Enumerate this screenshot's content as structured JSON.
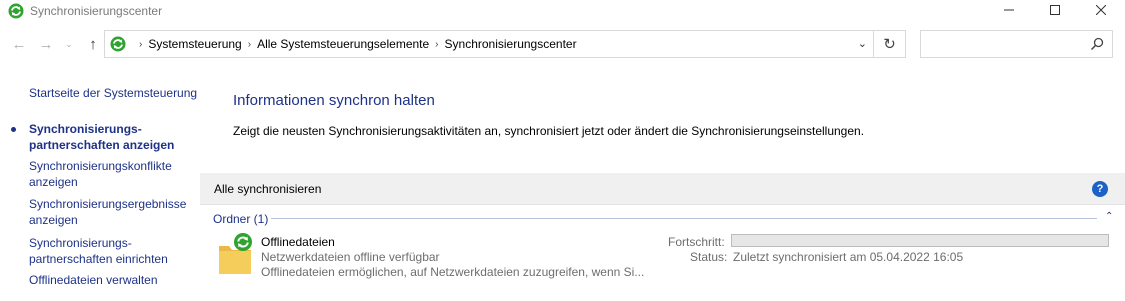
{
  "window": {
    "title": "Synchronisierungscenter",
    "controls": {
      "minimize": "—",
      "maximize": "☐",
      "close": "✕"
    }
  },
  "nav": {
    "back": "←",
    "forward": "→",
    "recent": "⌄",
    "up": "↑",
    "breadcrumbs": [
      "Systemsteuerung",
      "Alle Systemsteuerungselemente",
      "Synchronisierungscenter"
    ],
    "refresh": "↻",
    "search": {
      "value": "",
      "placeholder": ""
    }
  },
  "sidebar": {
    "items": [
      {
        "label": "Startseite der Systemsteuerung"
      },
      {
        "label_line1": "Synchronisierungs-",
        "label_line2": "partnerschaften anzeigen",
        "active": true
      },
      {
        "label_line1": "Synchronisierungskonflikte",
        "label_line2": "anzeigen"
      },
      {
        "label_line1": "Synchronisierungsergebnisse",
        "label_line2": "anzeigen"
      },
      {
        "label_line1": "Synchronisierungs-",
        "label_line2": "partnerschaften einrichten"
      },
      {
        "label": "Offlinedateien verwalten"
      }
    ]
  },
  "main": {
    "heading": "Informationen synchron halten",
    "description": "Zeigt die neusten Synchronisierungsaktivitäten an, synchronisiert jetzt oder ändert die Synchronisierungseinstellungen.",
    "toolbar": {
      "sync_all": "Alle synchronisieren",
      "help": "?"
    },
    "group": {
      "header": "Ordner (1)",
      "collapse": "⌃"
    },
    "item": {
      "name": "Offlinedateien",
      "subtitle": "Netzwerkdateien offline verfügbar",
      "description": "Offlinedateien ermöglichen, auf Netzwerkdateien zuzugreifen, wenn Si...",
      "progress_label": "Fortschritt:",
      "progress_value": 0,
      "status_label": "Status:",
      "status_value": "Zuletzt synchronisiert am 05.04.2022 16:05"
    }
  },
  "colors": {
    "link": "#1e3287",
    "sync_green": "#2fa32f",
    "folder_yellow": "#f5cd5b",
    "help_blue": "#1c62c6"
  },
  "icons": {
    "app": "sync-icon",
    "folder": "folder-sync-icon",
    "search": "search-icon",
    "help": "help-icon"
  }
}
